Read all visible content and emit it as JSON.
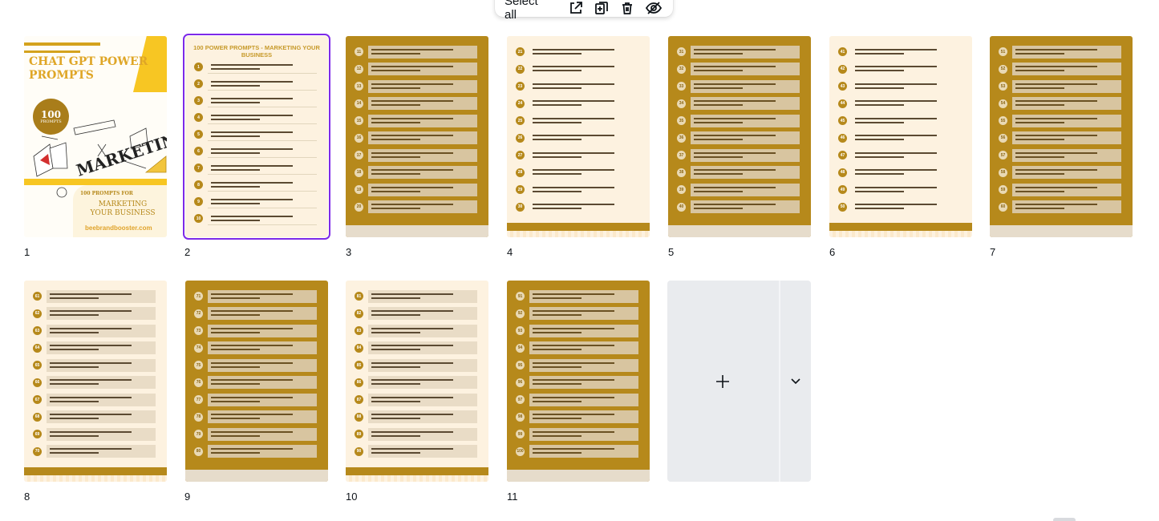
{
  "toolbar": {
    "select_all_label": "Select all",
    "icons": [
      "share-page-icon",
      "add-page-icon",
      "trash-icon",
      "hide-icon"
    ]
  },
  "cover": {
    "title": "CHAT GPT POWER PROMPTS",
    "badge_number": "100",
    "badge_label": "PROMPTS",
    "subtitle": "100 PROMPTS FOR",
    "subtitle2": "MARKETING YOUR BUSINESS",
    "site": "beebrandbooster.com",
    "sketch_word": "MARKETING"
  },
  "page2": {
    "heading": "100 POWER PROMPTS - MARKETING YOUR BUSINESS"
  },
  "pages": [
    {
      "number": "1",
      "selected": false
    },
    {
      "number": "2",
      "selected": true
    },
    {
      "number": "3",
      "selected": false
    },
    {
      "number": "4",
      "selected": false
    },
    {
      "number": "5",
      "selected": false
    },
    {
      "number": "6",
      "selected": false
    },
    {
      "number": "7",
      "selected": false
    },
    {
      "number": "8",
      "selected": false
    },
    {
      "number": "9",
      "selected": false
    },
    {
      "number": "10",
      "selected": false
    },
    {
      "number": "11",
      "selected": false
    }
  ],
  "add_page": {
    "icon": "plus-icon",
    "menu_icon": "chevron-down-icon"
  },
  "colors": {
    "accent": "#7d2ae8",
    "gold": "#b6891b",
    "cream": "#fdf2e0"
  }
}
